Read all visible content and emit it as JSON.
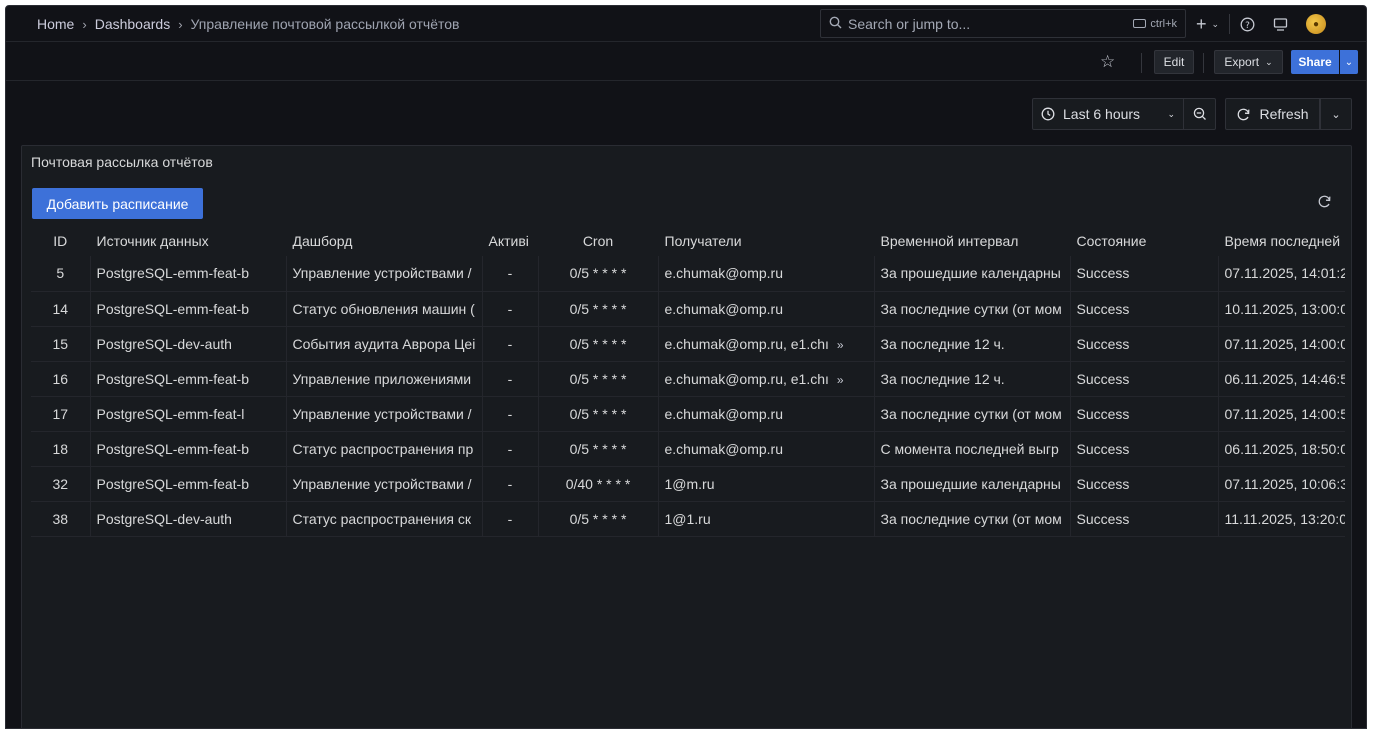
{
  "breadcrumb": {
    "home": "Home",
    "dashboards": "Dashboards",
    "current": "Управление почтовой рассылкой отчётов"
  },
  "search": {
    "placeholder": "Search or jump to...",
    "shortcut": "ctrl+k"
  },
  "nav": {
    "add_label": "+"
  },
  "toolbar": {
    "edit_label": "Edit",
    "export_label": "Export",
    "share_label": "Share"
  },
  "time": {
    "range_label": "Last 6 hours",
    "refresh_label": "Refresh"
  },
  "panel": {
    "title": "Почтовая рассылка отчётов",
    "add_button": "Добавить расписание",
    "columns": [
      "ID",
      "Источник данных",
      "Дашборд",
      "Активі",
      "Cron",
      "Получатели",
      "Временной интервал",
      "Состояние",
      "Время последней"
    ],
    "rows": [
      {
        "id": "5",
        "source": "PostgreSQL-emm-feat-b",
        "dashboard": "Управление устройствами /",
        "active": "-",
        "cron": "0/5 * * * *",
        "recipients": "e.chumak@omp.ru",
        "more": "",
        "interval": "За прошедшие календарны",
        "state": "Success",
        "last": "07.11.2025, 14:01:2"
      },
      {
        "id": "14",
        "source": "PostgreSQL-emm-feat-b",
        "dashboard": "Статус обновления машин (",
        "active": "-",
        "cron": "0/5 * * * *",
        "recipients": "e.chumak@omp.ru",
        "more": "",
        "interval": "За последние сутки (от мом",
        "state": "Success",
        "last": "10.11.2025, 13:00:0"
      },
      {
        "id": "15",
        "source": "PostgreSQL-dev-auth",
        "dashboard": "События аудита Аврора Цеі",
        "active": "-",
        "cron": "0/5 * * * *",
        "recipients": "e.chumak@omp.ru, e1.chı",
        "more": "»",
        "interval": "За последние 12 ч.",
        "state": "Success",
        "last": "07.11.2025, 14:00:0"
      },
      {
        "id": "16",
        "source": "PostgreSQL-emm-feat-b",
        "dashboard": "Управление приложениями",
        "active": "-",
        "cron": "0/5 * * * *",
        "recipients": "e.chumak@omp.ru, e1.chı",
        "more": "»",
        "interval": "За последние 12 ч.",
        "state": "Success",
        "last": "06.11.2025, 14:46:5"
      },
      {
        "id": "17",
        "source": "PostgreSQL-emm-feat-l",
        "dashboard": "Управление устройствами /",
        "active": "-",
        "cron": "0/5 * * * *",
        "recipients": "e.chumak@omp.ru",
        "more": "",
        "interval": "За последние сутки (от мом",
        "state": "Success",
        "last": "07.11.2025, 14:00:5"
      },
      {
        "id": "18",
        "source": "PostgreSQL-emm-feat-b",
        "dashboard": "Статус распространения пр",
        "active": "-",
        "cron": "0/5 * * * *",
        "recipients": "e.chumak@omp.ru",
        "more": "",
        "interval": "С момента последней выгр",
        "state": "Success",
        "last": "06.11.2025, 18:50:0"
      },
      {
        "id": "32",
        "source": "PostgreSQL-emm-feat-b",
        "dashboard": "Управление устройствами /",
        "active": "-",
        "cron": "0/40 * * * *",
        "recipients": "1@m.ru",
        "more": "",
        "interval": "За прошедшие календарны",
        "state": "Success",
        "last": "07.11.2025, 10:06:3"
      },
      {
        "id": "38",
        "source": "PostgreSQL-dev-auth",
        "dashboard": "Статус распространения ск",
        "active": "-",
        "cron": "0/5 * * * *",
        "recipients": "1@1.ru",
        "more": "",
        "interval": "За последние сутки (от мом",
        "state": "Success",
        "last": "11.11.2025, 13:20:0"
      }
    ]
  }
}
